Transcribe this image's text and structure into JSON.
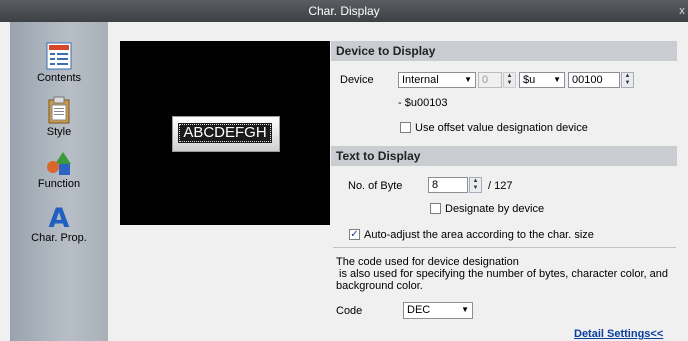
{
  "window": {
    "title": "Char. Display",
    "close_glyph": "x"
  },
  "sidebar": {
    "items": [
      {
        "label": "Contents",
        "icon": "contents-icon"
      },
      {
        "label": "Style",
        "icon": "style-icon"
      },
      {
        "label": "Function",
        "icon": "function-icon"
      },
      {
        "label": "Char. Prop.",
        "icon": "char-prop-icon"
      }
    ]
  },
  "preview": {
    "text": "ABCDEFGH"
  },
  "device_section": {
    "title": "Device to Display",
    "device_label": "Device",
    "device_type": "Internal",
    "station_value": "0",
    "device_name": "$u",
    "device_address": "00100",
    "range_text": "- $u00103",
    "offset_checkbox_label": "Use offset value designation device",
    "offset_checked": false
  },
  "text_section": {
    "title": "Text to Display",
    "bytes_label": "No. of Byte",
    "bytes_value": "8",
    "bytes_max": "/ 127",
    "designate_label": "Designate by device",
    "designate_checked": false,
    "auto_adjust_label": "Auto-adjust the area according to the char. size",
    "auto_adjust_checked": true,
    "info_line1": "The code used for device designation",
    "info_line2": " is also used for specifying the number of bytes, character color, and",
    "info_line3": "background color.",
    "code_label": "Code",
    "code_value": "DEC",
    "detail_link": "Detail Settings<<"
  }
}
